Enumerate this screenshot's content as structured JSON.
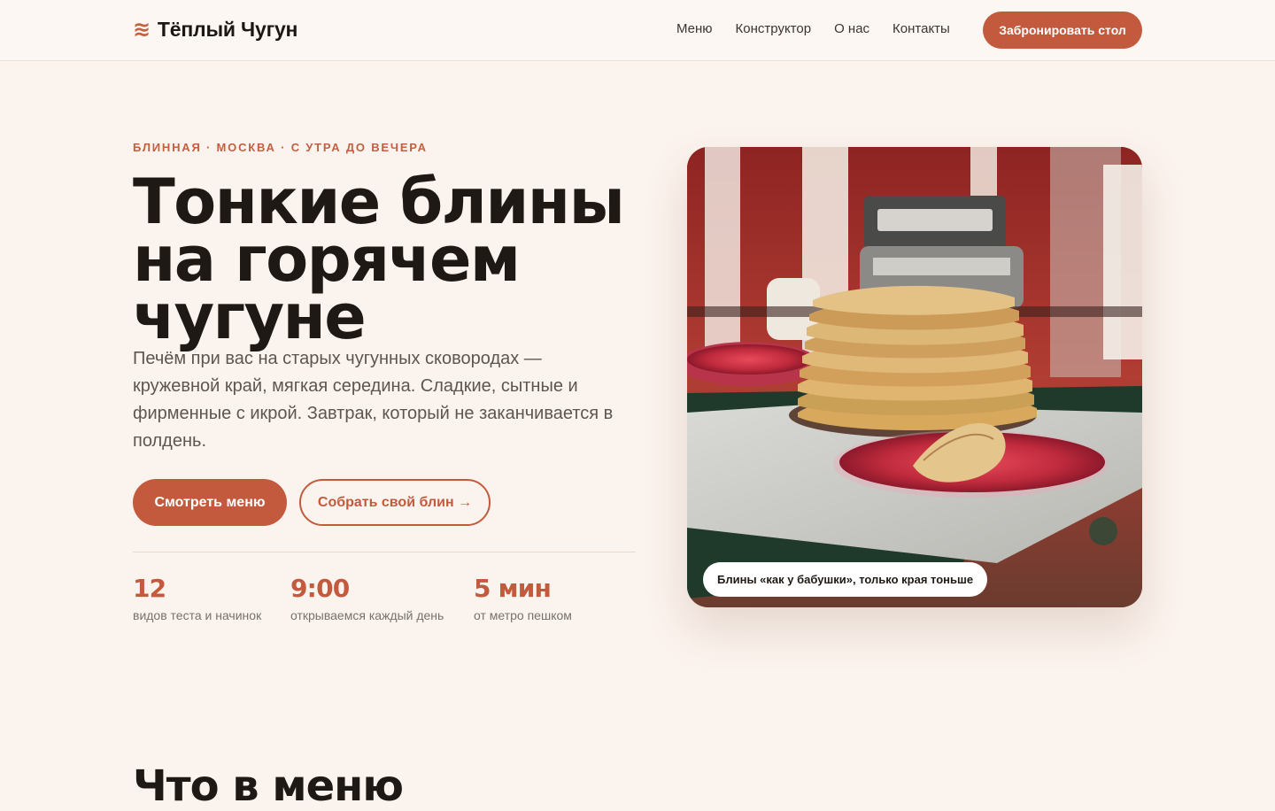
{
  "header": {
    "brand_icon": "wave-icon",
    "brand_icon_glyph": "≋",
    "brand_name": "Тёплый Чугун",
    "nav": [
      {
        "label": "Меню"
      },
      {
        "label": "Конструктор"
      },
      {
        "label": "О нас"
      },
      {
        "label": "Контакты"
      }
    ],
    "cta_label": "Забронировать стол"
  },
  "hero": {
    "eyebrow": "БЛИННАЯ · МОСКВА · С УТРА ДО ВЕЧЕРА",
    "title": "Тонкие блины на горячем чугуне",
    "description": "Печём при вас на старых чугунных сковородах — кружевной край, мягкая середина. Сладкие, сытные и фирменные с икрой. Завтрак, который не заканчивается в полдень.",
    "primary_button": "Смотреть меню",
    "secondary_button": "Собрать свой блин →",
    "stats": [
      {
        "value": "12",
        "label": "видов теста и начинок"
      },
      {
        "value": "9:00",
        "label": "открываемся каждый день"
      },
      {
        "value": "5 мин",
        "label": "от метро пешком"
      }
    ],
    "photo_caption": "Блины «как у бабушки», только края тоньше"
  },
  "menu_section": {
    "heading": "Что в меню"
  },
  "colors": {
    "accent": "#c35a3d",
    "background": "#fbf3ee",
    "text": "#1f1915",
    "muted": "#5d5550"
  }
}
